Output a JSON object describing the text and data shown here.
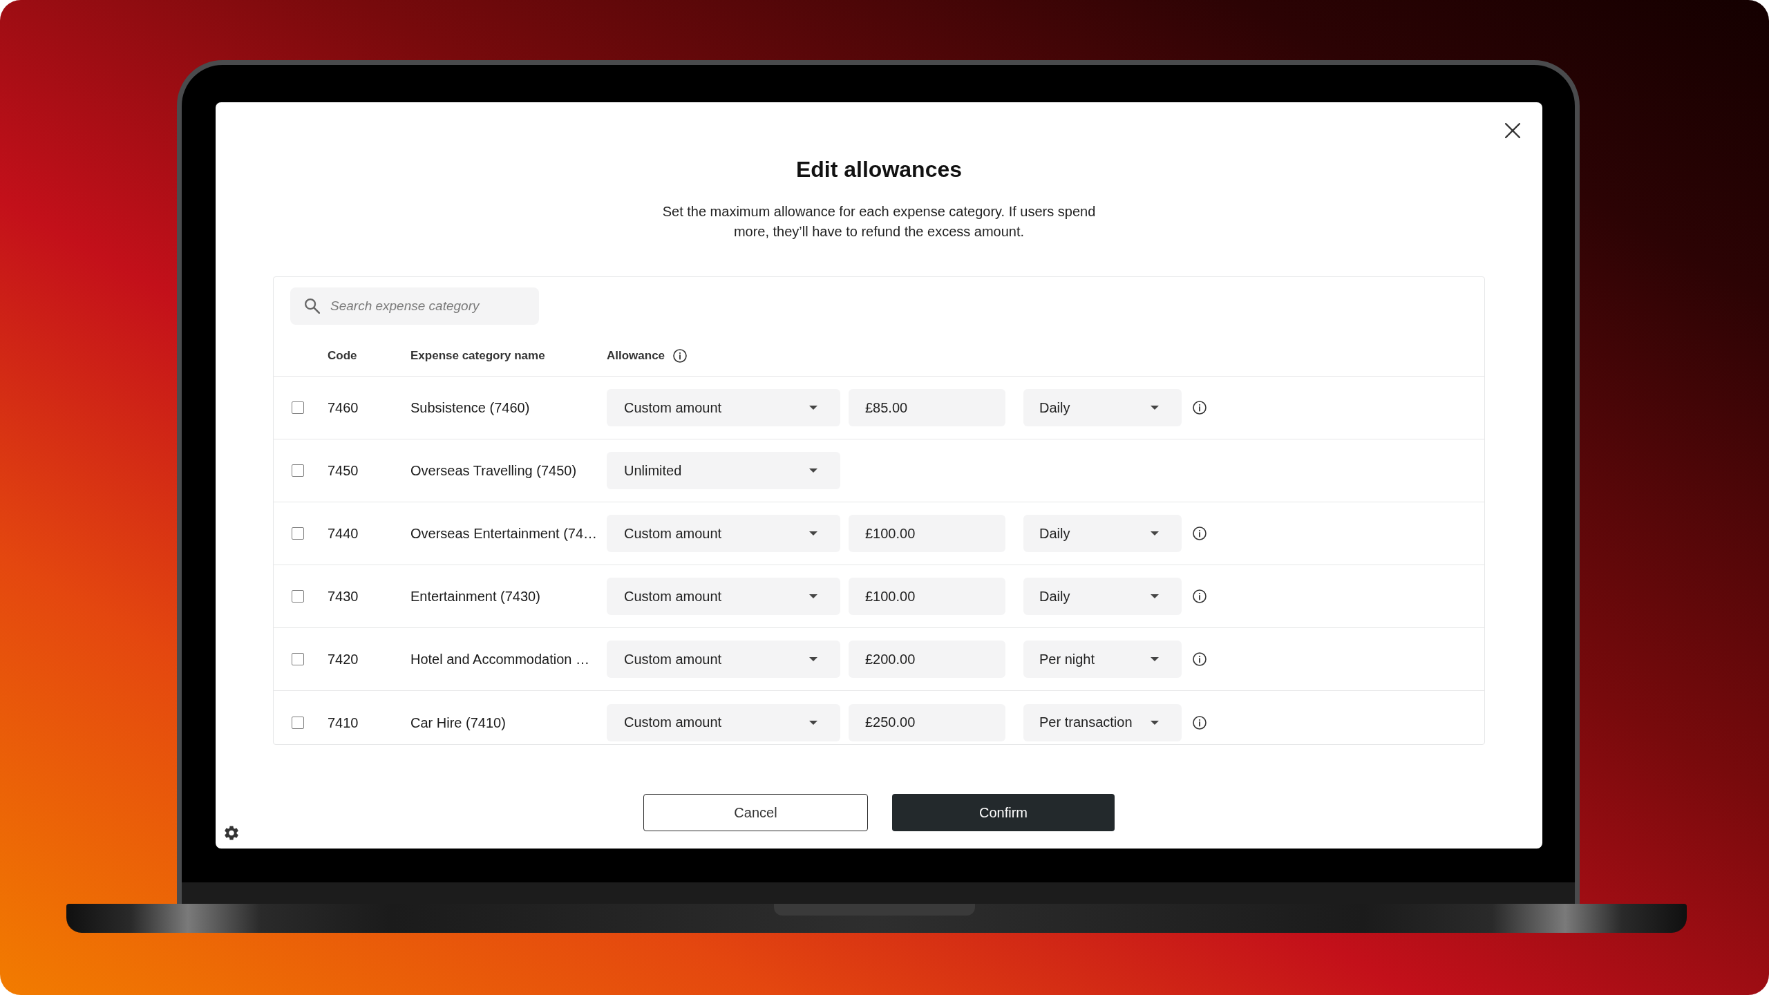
{
  "dialog": {
    "title": "Edit allowances",
    "description": "Set the maximum allowance for each expense category. If users spend more, they’ll have to refund the excess amount."
  },
  "search": {
    "placeholder": "Search expense category"
  },
  "table": {
    "columns": [
      {
        "label": "Code",
        "info": false
      },
      {
        "label": "Expense category name",
        "info": false
      },
      {
        "label": "Allowance",
        "info": true
      }
    ],
    "rows": [
      {
        "checked": false,
        "code": "7460",
        "name": "Subsistence (7460)",
        "allowance": "Custom amount",
        "amount": "£85.00",
        "period": "Daily"
      },
      {
        "checked": false,
        "code": "7450",
        "name": "Overseas Travelling (7450)",
        "allowance": "Unlimited"
      },
      {
        "checked": false,
        "code": "7440",
        "name": "Overseas Entertainment (74…",
        "allowance": "Custom amount",
        "amount": "£100.00",
        "period": "Daily"
      },
      {
        "checked": false,
        "code": "7430",
        "name": "Entertainment (7430)",
        "allowance": "Custom amount",
        "amount": "£100.00",
        "period": "Daily"
      },
      {
        "checked": false,
        "code": "7420",
        "name": "Hotel and Accommodation …",
        "allowance": "Custom amount",
        "amount": "£200.00",
        "period": "Per night"
      },
      {
        "checked": false,
        "code": "7410",
        "name": "Car Hire (7410)",
        "allowance": "Custom amount",
        "amount": "£250.00",
        "period": "Per transaction"
      }
    ]
  },
  "buttons": [
    {
      "label": "Cancel",
      "kind": "secondary"
    },
    {
      "label": "Confirm",
      "kind": "primary"
    }
  ]
}
